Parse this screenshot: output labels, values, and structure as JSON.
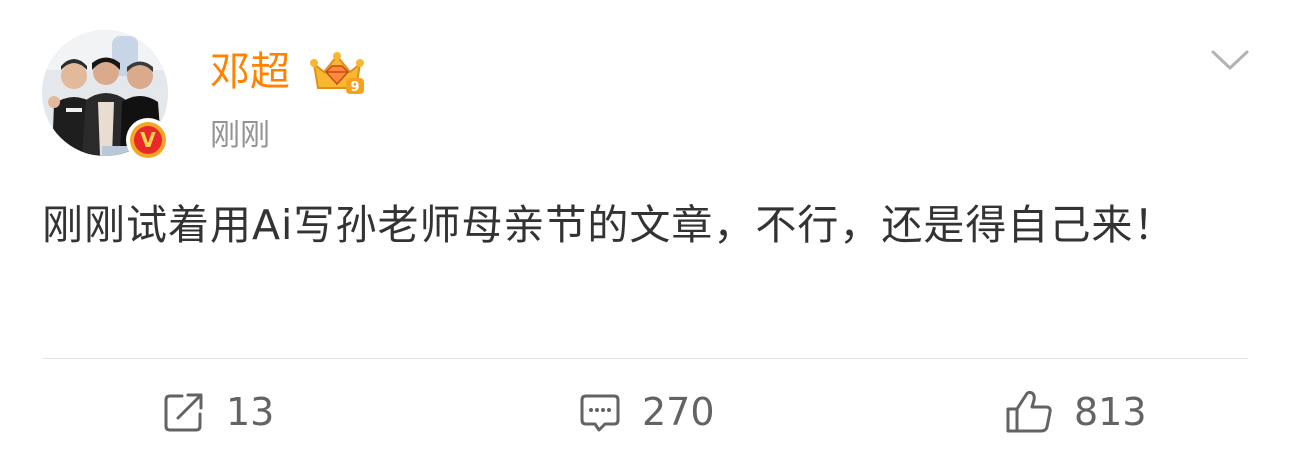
{
  "user": {
    "name": "邓超",
    "avatar_icon": "group-photo-avatar-icon",
    "verified_icon": "verified-v-icon",
    "verified_glyph": "V",
    "vip_icon": "crown-diamond-vip-icon",
    "vip_level": "9"
  },
  "post": {
    "time": "刚刚",
    "text": "刚刚试着用Ai写孙老师母亲节的文章，不行，还是得自己来！"
  },
  "menu": {
    "icon": "chevron-down-icon"
  },
  "actions": {
    "repost": {
      "icon": "repost-icon",
      "count": "13"
    },
    "comment": {
      "icon": "comment-icon",
      "count": "270"
    },
    "like": {
      "icon": "thumbs-up-icon",
      "count": "813"
    }
  },
  "colors": {
    "username": "#ff8200",
    "timestamp": "#939393",
    "text": "#333333",
    "action": "#636363",
    "divider": "#e6e6e6",
    "verified": "#e8282b"
  }
}
